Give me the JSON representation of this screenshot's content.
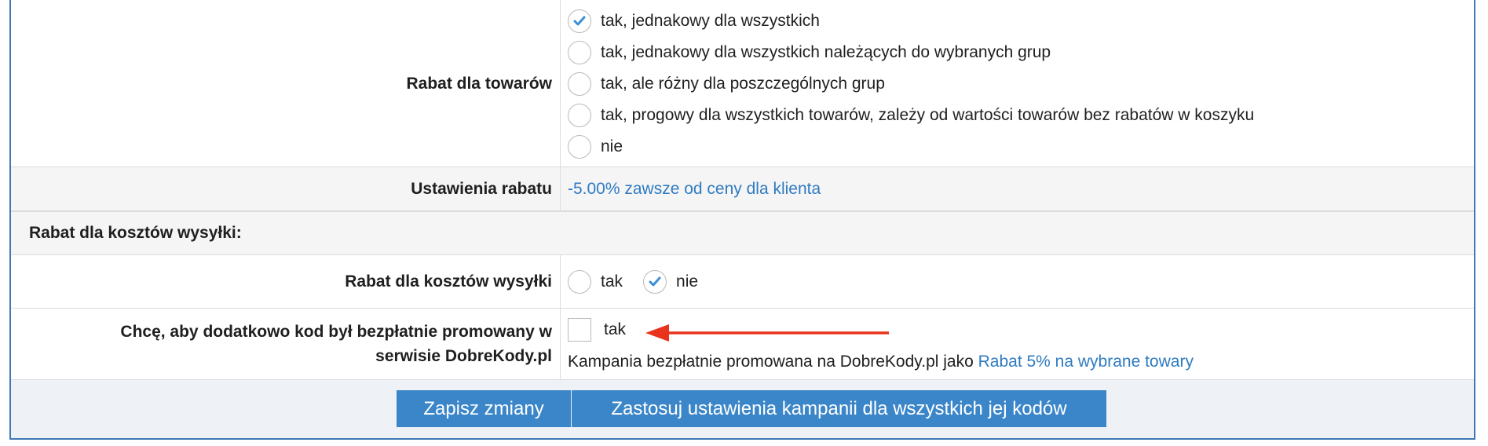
{
  "rabat_towarow": {
    "label": "Rabat dla towarów",
    "options": [
      {
        "label": "tak, jednakowy dla wszystkich",
        "checked": true
      },
      {
        "label": "tak, jednakowy dla wszystkich należących do wybranych grup",
        "checked": false
      },
      {
        "label": "tak, ale różny dla poszczególnych grup",
        "checked": false
      },
      {
        "label": "tak, progowy dla wszystkich towarów, zależy od wartości towarów bez rabatów w koszyku",
        "checked": false
      },
      {
        "label": "nie",
        "checked": false
      }
    ]
  },
  "ustawienia_rabatu": {
    "label": "Ustawienia rabatu",
    "value_link": "-5.00% zawsze od ceny dla klienta"
  },
  "sekcja_wysylki": {
    "title": "Rabat dla kosztów wysyłki:"
  },
  "rabat_wysylki": {
    "label": "Rabat dla kosztów wysyłki",
    "options": [
      {
        "label": "tak",
        "checked": false
      },
      {
        "label": "nie",
        "checked": true
      }
    ]
  },
  "promocja": {
    "label_line1": "Chcę, aby dodatkowo kod był bezpłatnie promowany w",
    "label_line2": "serwisie DobreKody.pl",
    "checkbox_label": "tak",
    "checked": false,
    "info_text": "Kampania bezpłatnie promowana na DobreKody.pl jako",
    "info_link": "Rabat 5% na wybrane towary"
  },
  "buttons": {
    "save": "Zapisz zmiany",
    "apply_all": "Zastosuj ustawienia kampanii dla wszystkich jej kodów"
  },
  "colors": {
    "accent": "#3b86c9",
    "link": "#2f7bc1",
    "border": "#3f78b5",
    "annotation_arrow": "#e8341c"
  }
}
